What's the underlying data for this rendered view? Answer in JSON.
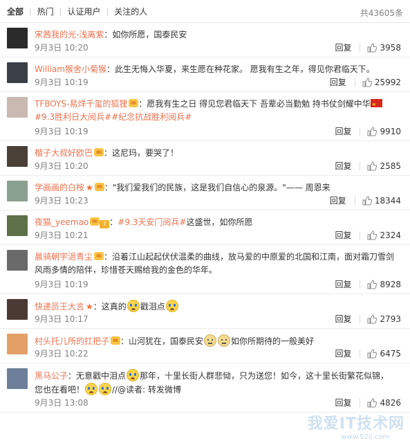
{
  "tabs": {
    "items": [
      "全部",
      "热门",
      "认证用户",
      "关注的人"
    ],
    "total": "共43605条"
  },
  "actions": {
    "reply_label": "回复"
  },
  "colors": {
    "username": "#eb7350",
    "meta": "#808080",
    "like_icon": "#888888"
  },
  "comments": [
    {
      "username": "宋茜我的光-浅离紫",
      "parts": [
        {
          "t": "text",
          "v": "：如你所愿，国泰民安"
        }
      ],
      "time": "9月3日 10:20",
      "likes": "3958"
    },
    {
      "username": "William猴舍小菊猴",
      "parts": [
        {
          "t": "text",
          "v": "：此生无悔入华夏，来生愿在种花家。 愿我有生之年，得见你君临天下。"
        }
      ],
      "time": "9月3日 10:19",
      "likes": "25992"
    },
    {
      "username": "TFBOYS-易烊千玺的狐狸",
      "badge": "crown",
      "parts": [
        {
          "t": "text",
          "v": "：愿我有生之日 得见您君临天下 吾辈必当勤勉 持书仗剑耀中华"
        },
        {
          "t": "flag"
        },
        {
          "t": "hashtag",
          "v": "#9.3胜利日大阅兵##纪念抗战胜利阅兵#"
        }
      ],
      "time": "9月3日 10:19",
      "likes": "9910"
    },
    {
      "username": "楷子大叔好欧巴",
      "badge": "crown",
      "parts": [
        {
          "t": "text",
          "v": "：这尼玛，要哭了！"
        }
      ],
      "time": "9月3日 10:20",
      "likes": "2585"
    },
    {
      "username": "学画画的白桉",
      "badge": "star-crown",
      "parts": [
        {
          "t": "text",
          "v": "：\"我们爱我们的民族，这是我们自信心的泉源。\"—— 周恩来"
        }
      ],
      "time": "9月3日 10:23",
      "likes": "18344"
    },
    {
      "username": "夜猫_yeemao",
      "badge": "crown-vip",
      "parts": [
        {
          "t": "text",
          "v": "："
        },
        {
          "t": "hashtag",
          "v": "#9.3天安门阅兵#"
        },
        {
          "t": "text",
          "v": "这盛世，如你所愿"
        }
      ],
      "time": "9月3日 10:21",
      "likes": "2324"
    },
    {
      "username": "晨骑朝宇浥青尘",
      "badge": "crown",
      "parts": [
        {
          "t": "text",
          "v": "：沿着江山起起伏伏温柔的曲线，放马爱的中原爱的北国和江南，面对霜刀雪剑风雨多情的陪伴，珍惜苍天赐给我的金色的华年。"
        }
      ],
      "time": "9月3日 10:19",
      "likes": "8928"
    },
    {
      "username": "快递员王大言",
      "badge": "star",
      "parts": [
        {
          "t": "text",
          "v": "：这真的"
        },
        {
          "t": "emoji"
        },
        {
          "t": "text",
          "v": "戳泪点"
        },
        {
          "t": "emoji"
        }
      ],
      "time": "9月3日 10:17",
      "likes": "2793"
    },
    {
      "username": "村头托儿所的扛把子",
      "badge": "crown",
      "parts": [
        {
          "t": "text",
          "v": "：山河犹在，国泰民安"
        },
        {
          "t": "sad"
        },
        {
          "t": "sad"
        },
        {
          "t": "text",
          "v": "如你所期待的一般美好"
        }
      ],
      "time": "9月3日 10:22",
      "likes": "6475"
    },
    {
      "username": "黑马公子",
      "parts": [
        {
          "t": "text",
          "v": "：无意戳中泪点"
        },
        {
          "t": "emoji"
        },
        {
          "t": "text",
          "v": "那年，十里长街人群悲恸，只为送您！如今，这十里长街繁花似锦，您也在看吧！"
        },
        {
          "t": "emoji"
        },
        {
          "t": "emoji"
        },
        {
          "t": "text",
          "v": "//@读者: 转发微博"
        }
      ],
      "time": "9月3日 13:08",
      "likes": "4826"
    }
  ],
  "watermark": {
    "main": "我爱IT技术网",
    "sub": "www.52ij.com"
  }
}
